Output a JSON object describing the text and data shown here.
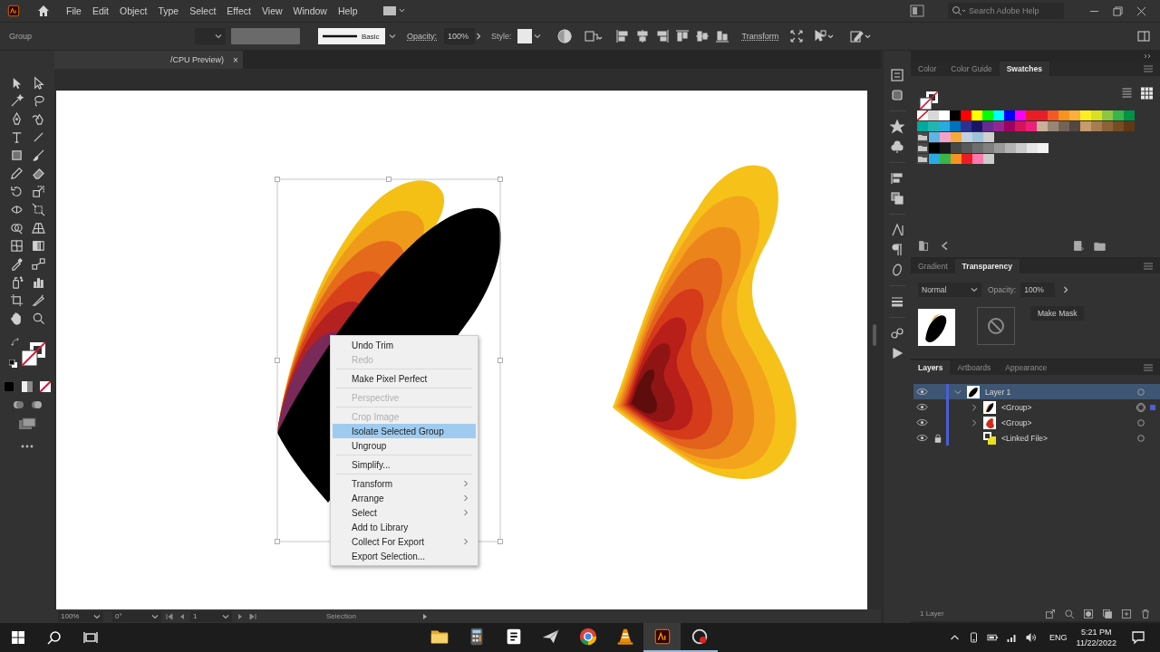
{
  "menu_bar": {
    "menus": [
      "File",
      "Edit",
      "Object",
      "Type",
      "Select",
      "Effect",
      "View",
      "Window",
      "Help"
    ],
    "search": {
      "placeholder": "Search Adobe Help"
    }
  },
  "control_bar": {
    "selection": "Group",
    "stroke_style": "Basic",
    "opacity_label": "Opacity:",
    "opacity_value": "100%",
    "style_label": "Style:",
    "transform": "Transform"
  },
  "document_tab": {
    "title": "/CPU Preview)",
    "close": "×"
  },
  "context_menu": {
    "groups": [
      [
        {
          "label": "Undo Trim",
          "disabled": false,
          "submenu": false,
          "selected": false
        },
        {
          "label": "Redo",
          "disabled": true,
          "submenu": false,
          "selected": false
        }
      ],
      [
        {
          "label": "Make Pixel Perfect",
          "disabled": false,
          "submenu": false,
          "selected": false
        }
      ],
      [
        {
          "label": "Perspective",
          "disabled": true,
          "submenu": false,
          "selected": false
        }
      ],
      [
        {
          "label": "Crop Image",
          "disabled": true,
          "submenu": false,
          "selected": false
        },
        {
          "label": "Isolate Selected Group",
          "disabled": false,
          "submenu": false,
          "selected": true
        },
        {
          "label": "Ungroup",
          "disabled": false,
          "submenu": false,
          "selected": false
        }
      ],
      [
        {
          "label": "Simplify...",
          "disabled": false,
          "submenu": false,
          "selected": false
        }
      ],
      [
        {
          "label": "Transform",
          "disabled": false,
          "submenu": true,
          "selected": false
        },
        {
          "label": "Arrange",
          "disabled": false,
          "submenu": true,
          "selected": false
        },
        {
          "label": "Select",
          "disabled": false,
          "submenu": true,
          "selected": false
        },
        {
          "label": "Add to Library",
          "disabled": false,
          "submenu": false,
          "selected": false
        },
        {
          "label": "Collect For Export",
          "disabled": false,
          "submenu": true,
          "selected": false
        },
        {
          "label": "Export Selection...",
          "disabled": false,
          "submenu": false,
          "selected": false
        }
      ]
    ]
  },
  "panels": {
    "swatches": {
      "tabs": [
        {
          "label": "Color",
          "selected": false
        },
        {
          "label": "Color Guide",
          "selected": false
        },
        {
          "label": "Swatches",
          "selected": true
        }
      ],
      "rows": [
        {
          "group": false,
          "swatches": [
            {
              "kind": "none"
            },
            {
              "kind": "color",
              "color": "#d8d8d8"
            },
            {
              "kind": "color",
              "color": "#ffffff"
            },
            {
              "kind": "color",
              "color": "#000000"
            },
            {
              "kind": "color",
              "color": "#ff0000"
            },
            {
              "kind": "color",
              "color": "#ffff00"
            },
            {
              "kind": "color",
              "color": "#00ff00"
            },
            {
              "kind": "color",
              "color": "#00ffff"
            },
            {
              "kind": "color",
              "color": "#0000ff"
            },
            {
              "kind": "color",
              "color": "#ff00ff"
            },
            {
              "kind": "color",
              "color": "#ed1c24"
            },
            {
              "kind": "color",
              "color": "#e61e2a"
            },
            {
              "kind": "color",
              "color": "#f15a24"
            },
            {
              "kind": "color",
              "color": "#f7931e"
            },
            {
              "kind": "color",
              "color": "#fbb03b"
            },
            {
              "kind": "color",
              "color": "#fcee21"
            },
            {
              "kind": "color",
              "color": "#d9e021"
            },
            {
              "kind": "color",
              "color": "#8cc63f"
            },
            {
              "kind": "color",
              "color": "#39b54a"
            },
            {
              "kind": "color",
              "color": "#009245"
            }
          ]
        },
        {
          "group": false,
          "swatches": [
            {
              "kind": "color",
              "color": "#00a99d"
            },
            {
              "kind": "color",
              "color": "#22b5b0"
            },
            {
              "kind": "color",
              "color": "#29abe2"
            },
            {
              "kind": "color",
              "color": "#0071bc"
            },
            {
              "kind": "color",
              "color": "#2e3192"
            },
            {
              "kind": "color",
              "color": "#1b1464"
            },
            {
              "kind": "color",
              "color": "#662d91"
            },
            {
              "kind": "color",
              "color": "#93278f"
            },
            {
              "kind": "color",
              "color": "#9e005d"
            },
            {
              "kind": "color",
              "color": "#d4145a"
            },
            {
              "kind": "color",
              "color": "#ed1e79"
            },
            {
              "kind": "color",
              "color": "#c7b299"
            },
            {
              "kind": "color",
              "color": "#998675"
            },
            {
              "kind": "color",
              "color": "#736357"
            },
            {
              "kind": "color",
              "color": "#534741"
            },
            {
              "kind": "color",
              "color": "#c69c6d"
            },
            {
              "kind": "color",
              "color": "#a67c52"
            },
            {
              "kind": "color",
              "color": "#8c6239"
            },
            {
              "kind": "color",
              "color": "#754c24"
            },
            {
              "kind": "color",
              "color": "#603813"
            }
          ]
        },
        {
          "group": true,
          "swatches": [
            {
              "kind": "color",
              "color": "#5fb4e6"
            },
            {
              "kind": "color",
              "color": "#f4a3c8"
            },
            {
              "kind": "color",
              "color": "#f7a93b"
            },
            {
              "kind": "color",
              "color": "#c0d0e0"
            },
            {
              "kind": "color",
              "color": "#9fc3d9"
            },
            {
              "kind": "color",
              "color": "#d0d0d0"
            }
          ]
        },
        {
          "group": true,
          "swatches": [
            {
              "kind": "color",
              "color": "#000000"
            },
            {
              "kind": "color",
              "color": "#1a1a1a"
            },
            {
              "kind": "color",
              "color": "#474747"
            },
            {
              "kind": "color",
              "color": "#595959"
            },
            {
              "kind": "color",
              "color": "#6e6e6e"
            },
            {
              "kind": "color",
              "color": "#808080"
            },
            {
              "kind": "color",
              "color": "#999999"
            },
            {
              "kind": "color",
              "color": "#b3b3b3"
            },
            {
              "kind": "color",
              "color": "#cccccc"
            },
            {
              "kind": "color",
              "color": "#e6e6e6"
            },
            {
              "kind": "color",
              "color": "#f2f2f2"
            }
          ]
        },
        {
          "group": true,
          "swatches": [
            {
              "kind": "color",
              "color": "#29abe2"
            },
            {
              "kind": "color",
              "color": "#39b54a"
            },
            {
              "kind": "color",
              "color": "#f7931e"
            },
            {
              "kind": "color",
              "color": "#ed1c24"
            },
            {
              "kind": "color",
              "color": "#ff7bac"
            },
            {
              "kind": "color",
              "color": "#cccccc"
            }
          ]
        }
      ]
    },
    "transparency": {
      "tabs": [
        {
          "label": "Gradient",
          "selected": false
        },
        {
          "label": "Transparency",
          "selected": true
        }
      ],
      "blend_mode": "Normal",
      "opacity_label": "Opacity:",
      "opacity_value": "100%",
      "make_mask": "Make Mask"
    },
    "layers": {
      "tabs": [
        {
          "label": "Layers",
          "selected": true
        },
        {
          "label": "Artboards",
          "selected": false
        },
        {
          "label": "Appearance",
          "selected": false
        }
      ],
      "items": [
        {
          "name": "Layer 1",
          "kind": "layer",
          "color": "#4a5fd6",
          "expanded": true,
          "selected": true,
          "visible": true,
          "locked": false,
          "art_selected": false,
          "children": [
            {
              "name": "<Group>",
              "kind": "group",
              "expanded": false,
              "selected": false,
              "visible": true,
              "locked": false,
              "art_selected": true
            },
            {
              "name": "<Group>",
              "kind": "group",
              "expanded": false,
              "selected": false,
              "visible": true,
              "locked": false,
              "art_selected": false
            },
            {
              "name": "<Linked File>",
              "kind": "linked_file",
              "selected": false,
              "visible": true,
              "locked": true,
              "art_selected": false
            }
          ]
        }
      ],
      "footer": "1 Layer"
    }
  },
  "status_bar": {
    "zoom": "100%",
    "rotation": "0°",
    "artboard": "1",
    "tool": "Selection"
  },
  "taskbar": {
    "apps": [
      {
        "kind": "file_explorer",
        "active": false,
        "running": false
      },
      {
        "kind": "calculator",
        "active": false,
        "running": false
      },
      {
        "kind": "notebook",
        "active": false,
        "running": false
      },
      {
        "kind": "paper_plane",
        "active": false,
        "running": false
      },
      {
        "kind": "browser",
        "active": false,
        "running": false
      },
      {
        "kind": "media_player",
        "active": false,
        "running": false
      },
      {
        "kind": "illustrator",
        "active": true,
        "running": true
      },
      {
        "kind": "recorder",
        "active": false,
        "running": true
      }
    ],
    "language": "ENG",
    "time": "5:21 PM",
    "date": "11/22/2022"
  }
}
